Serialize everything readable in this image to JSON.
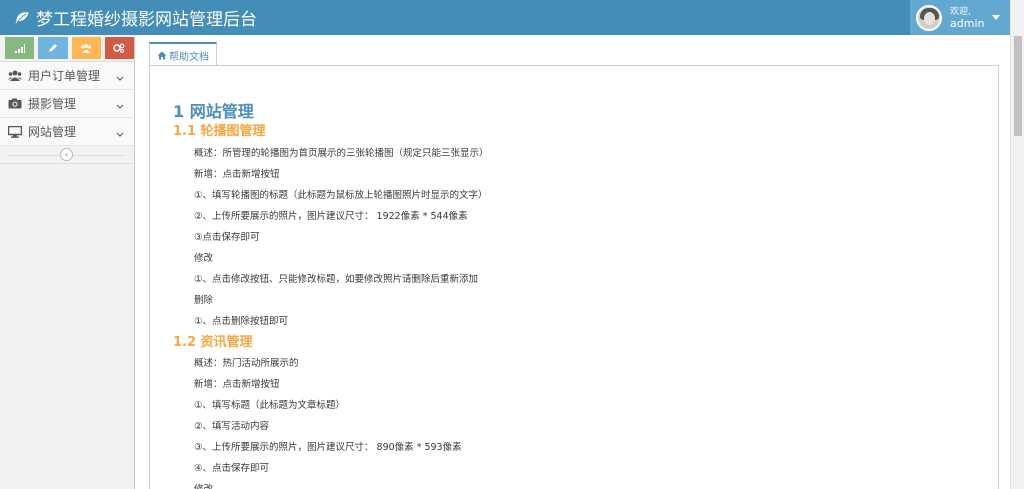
{
  "header": {
    "title": "梦工程婚纱摄影网站管理后台",
    "welcome": "欢迎,",
    "username": "admin"
  },
  "sidebar": {
    "items": [
      {
        "label": "用户订单管理",
        "icon": "users-icon"
      },
      {
        "label": "摄影管理",
        "icon": "camera-icon"
      },
      {
        "label": "网站管理",
        "icon": "desktop-icon"
      }
    ],
    "collapse_glyph": "«"
  },
  "tabs": [
    {
      "label": "帮助文档",
      "icon": "home-icon"
    }
  ],
  "doc": {
    "h1": "1 网站管理",
    "s1": {
      "title": "1.1 轮播图管理",
      "lines": [
        "概述：所管理的轮播图为首页展示的三张轮播图（规定只能三张显示）",
        "新增：点击新增按钮",
        "①、填写轮播图的标题（此标题为鼠标放上轮播图照片时显示的文字）",
        "②、上传所要展示的照片，图片建议尺寸： 1922像素 * 544像素",
        "③点击保存即可",
        "修改",
        "①、点击修改按钮、只能修改标题，如要修改照片请删除后重新添加",
        "删除",
        "①、点击删除按钮即可"
      ]
    },
    "s2": {
      "title": "1.2 资讯管理",
      "lines": [
        "概述：热门活动所展示的",
        "新增：点击新增按钮",
        "①、填写标题（此标题为文章标题）",
        "②、填写活动内容",
        "③、上传所要展示的照片，图片建议尺寸： 890像素 * 593像素",
        "④、点击保存即可",
        "修改"
      ]
    }
  },
  "colors": {
    "navbar": "#438eb9",
    "user_box": "#62a8d1",
    "heading_blue": "#4c8fbd",
    "heading_orange": "#f5a742"
  }
}
